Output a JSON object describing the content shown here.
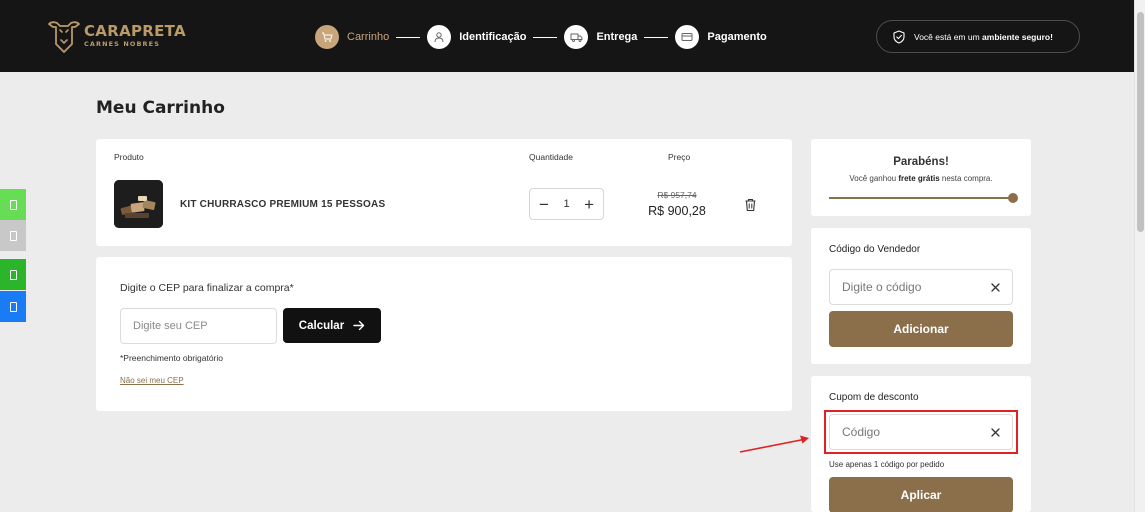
{
  "brand": {
    "name": "CARAPRETA",
    "tagline": "CARNES NOBRES",
    "color": "#b99a68"
  },
  "checkout_steps": [
    {
      "label": "Carrinho",
      "icon": "cart-icon",
      "active": true
    },
    {
      "label": "Identificação",
      "icon": "user-icon",
      "active": false
    },
    {
      "label": "Entrega",
      "icon": "truck-icon",
      "active": false
    },
    {
      "label": "Pagamento",
      "icon": "card-icon",
      "active": false
    }
  ],
  "secure_badge": {
    "text_prefix": "Você está em um ",
    "text_bold": "ambiente seguro!",
    "icon": "shield-check-icon"
  },
  "side_buttons": [
    {
      "icon": "phone-icon",
      "color": "#66dd55"
    },
    {
      "icon": "phone-icon",
      "color": "#c8c8c8"
    },
    {
      "icon": "phone-icon",
      "color": "#2bb52b"
    },
    {
      "icon": "phone-icon",
      "color": "#1a7cf5"
    }
  ],
  "page": {
    "title": "Meu Carrinho"
  },
  "cart": {
    "headers": {
      "product": "Produto",
      "quantity": "Quantidade",
      "price": "Preço"
    },
    "items": [
      {
        "name": "KIT CHURRASCO PREMIUM 15 PESSOAS",
        "quantity": "1",
        "old_price": "R$ 957,74",
        "price": "R$ 900,28"
      }
    ],
    "decrement_symbol": "−",
    "increment_symbol": "+"
  },
  "cep": {
    "title": "Digite o CEP para finalizar a compra*",
    "placeholder": "Digite seu CEP",
    "value": "",
    "button_label": "Calcular",
    "required_note": "*Preenchimento obrigatório",
    "link_label": "Não sei meu CEP"
  },
  "shipping_promo": {
    "title": "Parabéns!",
    "message_prefix": "Você ganhou ",
    "message_bold": "frete grátis",
    "message_suffix": " nesta compra.",
    "progress": 1.0
  },
  "vendor_code": {
    "title": "Código do Vendedor",
    "placeholder": "Digite o código",
    "value": "",
    "button_label": "Adicionar"
  },
  "coupon": {
    "title": "Cupom de desconto",
    "placeholder": "Código",
    "value": "",
    "note": "Use apenas 1 código por pedido",
    "button_label": "Aplicar"
  },
  "colors": {
    "accent": "#8b6f4a",
    "step_active": "#c9a57c",
    "header_bg": "#151515",
    "annotation": "#e02222"
  }
}
